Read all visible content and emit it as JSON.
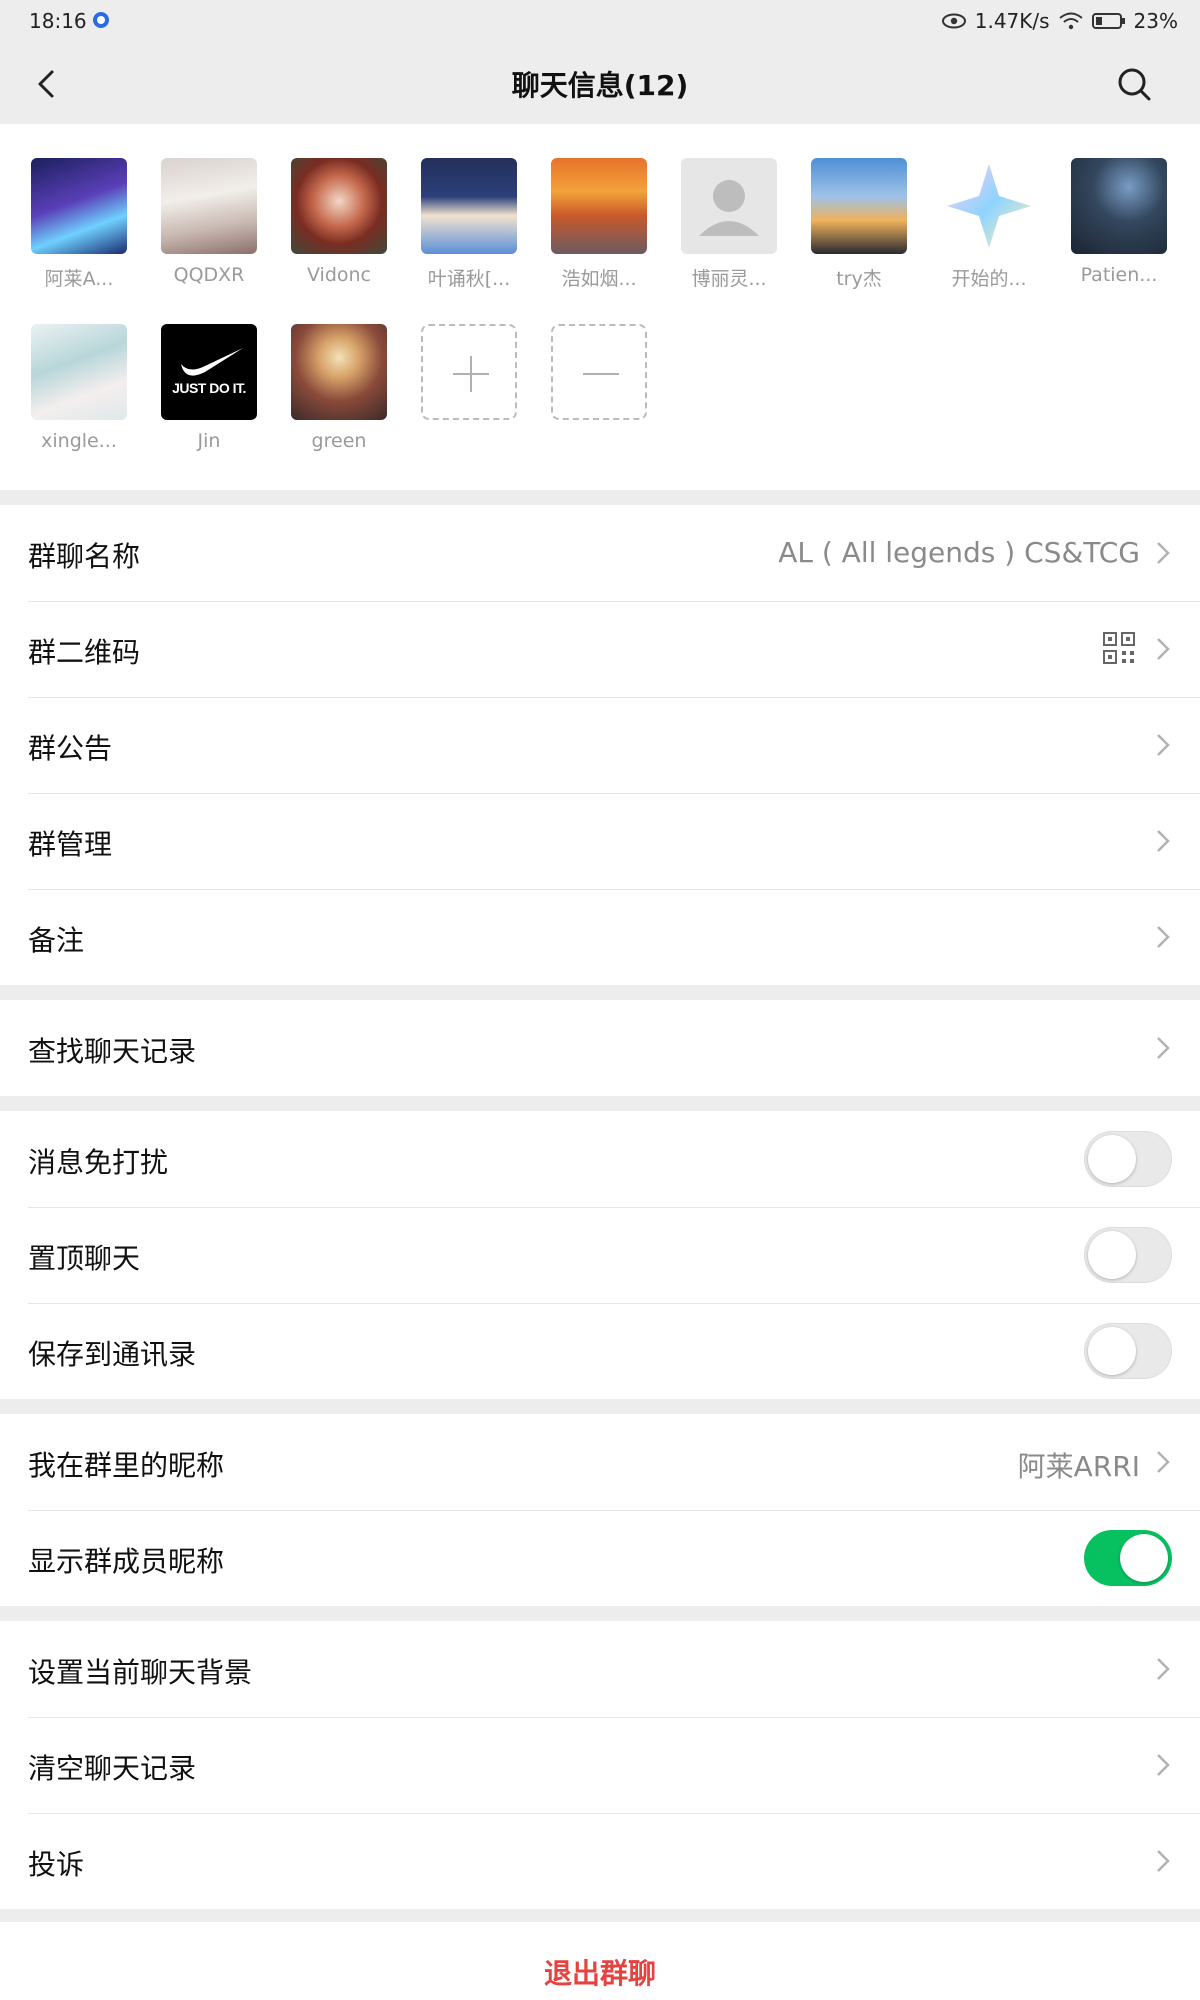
{
  "status_bar": {
    "time": "18:16",
    "network_speed": "1.47K/s",
    "battery": "23%"
  },
  "nav": {
    "title": "聊天信息(12)"
  },
  "members": [
    {
      "name": "阿莱A..."
    },
    {
      "name": "QQDXR"
    },
    {
      "name": "Vidonc"
    },
    {
      "name": "叶诵秋[..."
    },
    {
      "name": "浩如烟..."
    },
    {
      "name": "博丽灵..."
    },
    {
      "name": "try杰"
    },
    {
      "name": "开始的..."
    },
    {
      "name": "Patien..."
    },
    {
      "name": "xingle..."
    },
    {
      "name": "Jin",
      "avatar_text": "JUST DO IT."
    },
    {
      "name": "green"
    }
  ],
  "settings": {
    "group_name_label": "群聊名称",
    "group_name_value": "AL ( All legends ) CS&TCG",
    "qr_code_label": "群二维码",
    "announcement_label": "群公告",
    "manage_label": "群管理",
    "remark_label": "备注",
    "search_history_label": "查找聊天记录",
    "mute_label": "消息免打扰",
    "mute_on": false,
    "pin_label": "置顶聊天",
    "pin_on": false,
    "save_contacts_label": "保存到通讯录",
    "save_contacts_on": false,
    "my_nickname_label": "我在群里的昵称",
    "my_nickname_value": "阿莱ARRI",
    "show_nicknames_label": "显示群成员昵称",
    "show_nicknames_on": true,
    "background_label": "设置当前聊天背景",
    "clear_history_label": "清空聊天记录",
    "report_label": "投诉",
    "exit_label": "退出群聊"
  },
  "colors": {
    "accent_green": "#07c160",
    "danger_red": "#e64340",
    "background": "#ededed"
  }
}
